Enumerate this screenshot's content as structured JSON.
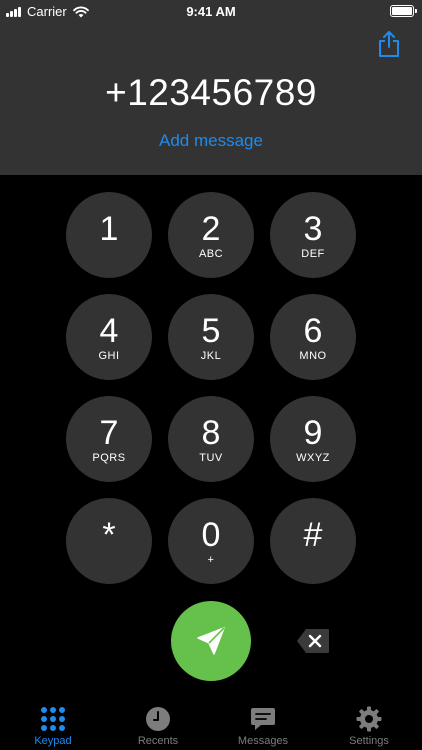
{
  "status_bar": {
    "carrier": "Carrier",
    "time": "9:41 AM"
  },
  "dialer": {
    "number": "+123456789",
    "add_message": "Add message"
  },
  "keys": [
    {
      "digit": "1",
      "letters": ""
    },
    {
      "digit": "2",
      "letters": "ABC"
    },
    {
      "digit": "3",
      "letters": "DEF"
    },
    {
      "digit": "4",
      "letters": "GHI"
    },
    {
      "digit": "5",
      "letters": "JKL"
    },
    {
      "digit": "6",
      "letters": "MNO"
    },
    {
      "digit": "7",
      "letters": "PQRS"
    },
    {
      "digit": "8",
      "letters": "TUV"
    },
    {
      "digit": "9",
      "letters": "WXYZ"
    },
    {
      "digit": "*",
      "letters": ""
    },
    {
      "digit": "0",
      "letters": "+"
    },
    {
      "digit": "#",
      "letters": ""
    }
  ],
  "tabs": [
    {
      "label": "Keypad",
      "icon": "keypad-icon",
      "active": true
    },
    {
      "label": "Recents",
      "icon": "clock-icon",
      "active": false
    },
    {
      "label": "Messages",
      "icon": "message-icon",
      "active": false
    },
    {
      "label": "Settings",
      "icon": "gear-icon",
      "active": false
    }
  ],
  "colors": {
    "accent": "#1e8bef",
    "call_button": "#65c14b",
    "key_background": "#333333",
    "header_background": "#333333",
    "inactive_tab": "#7d7d7d"
  }
}
